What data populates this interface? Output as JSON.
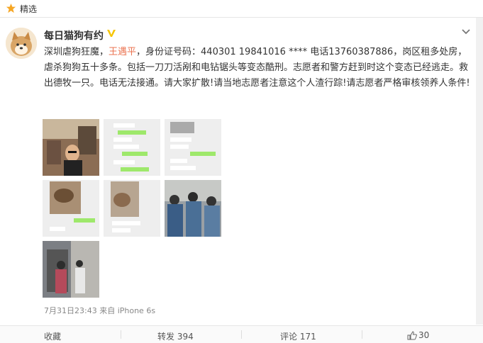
{
  "topbar": {
    "title": "精选"
  },
  "post": {
    "username": "每日猫狗有约",
    "text_before": "深圳虐狗狂魔，",
    "mention": "王遇平",
    "text_after": "，身份证号码：440301 19841016 **** 电话13760387886，岗区租多处房，虐杀狗狗五十多条。包括一刀刀活剐和电钻锯头等变态酷刑。志愿者和警方赶到时这个变态已经逃走。救出德牧一只。电话无法接通。请大家扩散!请当地志愿者注意这个人渣行踪!请志愿者严格审核领养人条件!",
    "meta": "7月31日23:43 来自 iPhone 6s"
  },
  "actions": {
    "collect": "收藏",
    "repost": "转发 394",
    "comment": "评论 171",
    "like": "30"
  },
  "colors": {
    "mention": "#eb7350",
    "vip": "#f6c500",
    "chat_green": "#9ee86b"
  },
  "icons": [
    "star-icon",
    "vip-icon",
    "menu-chevron-icon",
    "like-icon"
  ]
}
